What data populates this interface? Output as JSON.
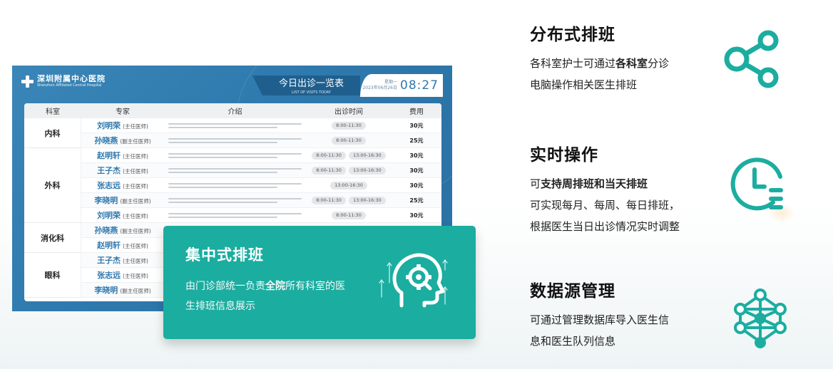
{
  "screen": {
    "logo_cn": "深圳附属中心医院",
    "logo_en": "Shenzhen Affiliated Central Hospital",
    "title_cn": "今日出诊一览表",
    "title_en": "LIST OF VISITS TODAY",
    "weekday": "星期一",
    "date": "2023年06月26日",
    "time": "08:27",
    "headers": [
      "科室",
      "专家",
      "介绍",
      "出诊时间",
      "费用"
    ],
    "departments": [
      {
        "name": "内科",
        "rows": 2
      },
      {
        "name": "外科",
        "rows": 5
      },
      {
        "name": "消化科",
        "rows": 2
      },
      {
        "name": "眼科",
        "rows": 3
      }
    ],
    "doctors": [
      {
        "name": "刘明荣",
        "title": "(主任医师)",
        "times": [
          "8:00-11:30"
        ],
        "fee": "30元"
      },
      {
        "name": "孙晓燕",
        "title": "(副主任医师)",
        "times": [
          "8:00-11:30"
        ],
        "fee": "25元"
      },
      {
        "name": "赵明轩",
        "title": "(主任医师)",
        "times": [
          "8:00-11:30",
          "13:00-16:30"
        ],
        "fee": "30元"
      },
      {
        "name": "王子杰",
        "title": "(主任医师)",
        "times": [
          "8:00-11:30",
          "13:00-16:30"
        ],
        "fee": "30元"
      },
      {
        "name": "张志远",
        "title": "(主任医师)",
        "times": [
          "13:00-16:30"
        ],
        "fee": "30元"
      },
      {
        "name": "李晓明",
        "title": "(副主任医师)",
        "times": [
          "8:00-11:30",
          "13:00-16:30"
        ],
        "fee": "25元"
      },
      {
        "name": "刘明荣",
        "title": "(主任医师)",
        "times": [
          "8:00-11:30"
        ],
        "fee": "30元"
      },
      {
        "name": "孙晓燕",
        "title": "(副主任医师)",
        "times": [],
        "fee": ""
      },
      {
        "name": "赵明轩",
        "title": "(主任医师)",
        "times": [],
        "fee": ""
      },
      {
        "name": "王子杰",
        "title": "(主任医师)",
        "times": [],
        "fee": ""
      },
      {
        "name": "张志远",
        "title": "(主任医师)",
        "times": [],
        "fee": ""
      },
      {
        "name": "李晓明",
        "title": "(副主任医师)",
        "times": [],
        "fee": ""
      }
    ]
  },
  "central": {
    "title": "集中式排班",
    "desc_pre": "由门诊部统一负责",
    "desc_bold": "全院",
    "desc_post": "所有科室的医生排班信息展示",
    "icon": "head-gear-icon"
  },
  "features": [
    {
      "title": "分布式排班",
      "line1_pre": "各科室护士可通过",
      "line1_bold": "各科室",
      "line1_post": "分诊",
      "line2": "电脑操作相关医生排班",
      "icon": "share-icon"
    },
    {
      "title": "实时操作",
      "line1_pre": "可",
      "line1_bold": "支持周排班和当天排班",
      "line2": "可实现每月、每周、每日排班，",
      "line3": "根据医生当日出诊情况实时调整",
      "icon": "clock-list-icon"
    },
    {
      "title": "数据源管理",
      "line1": "可通过管理数据库导入医生信",
      "line2": "息和医生队列信息",
      "icon": "network-icon"
    }
  ],
  "colors": {
    "teal": "#1bada0",
    "screen_blue": "#2e79ad",
    "name_blue": "#2f78ad"
  }
}
